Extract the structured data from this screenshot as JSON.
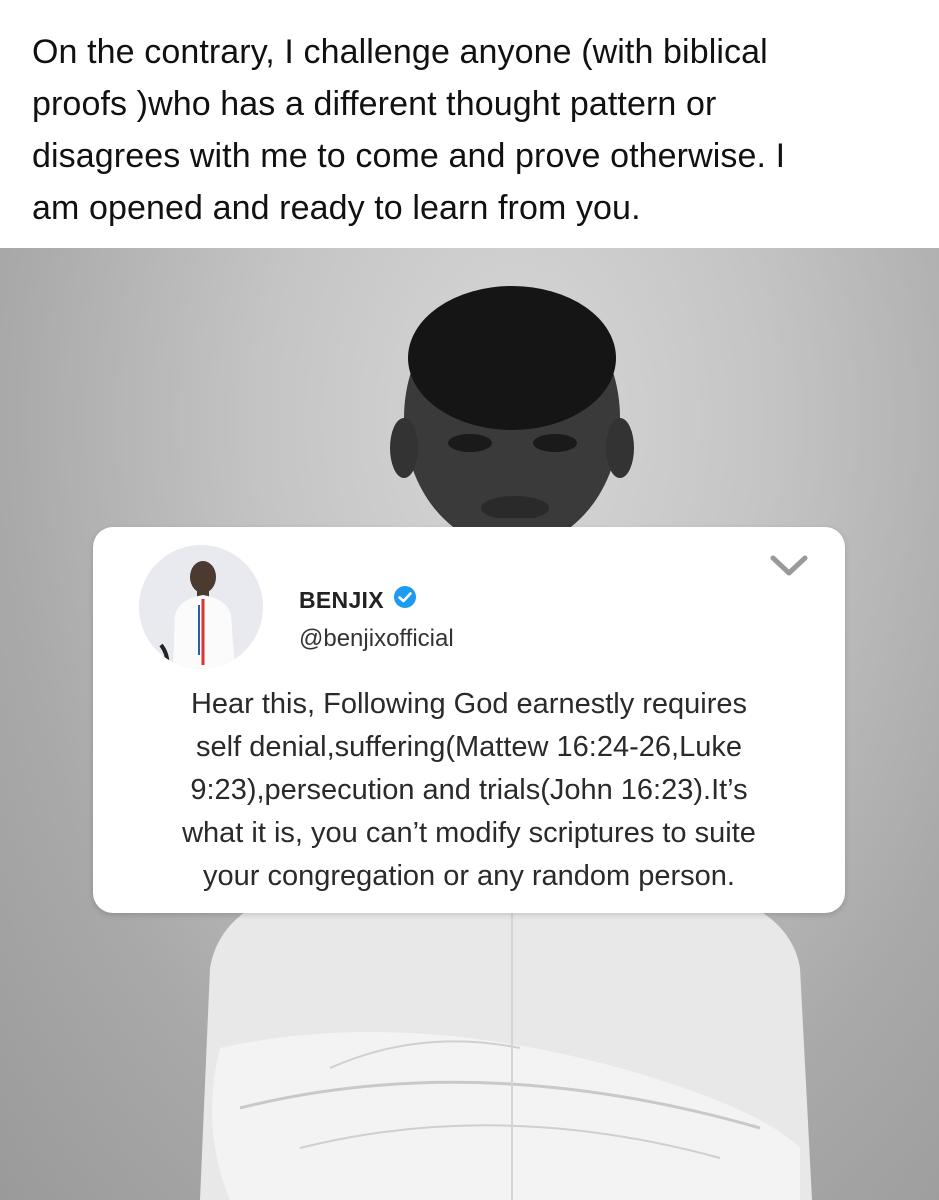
{
  "caption": {
    "line1": "On the contrary, I challenge anyone (with biblical",
    "line2": "proofs )who has a different thought pattern or",
    "line3": "disagrees with me to come and prove otherwise. I",
    "line4": "am opened and ready to learn from you."
  },
  "tweet": {
    "display_name": "BENJIX",
    "handle": "@benjixofficial",
    "verified_icon": "verified-badge-icon",
    "menu_icon": "chevron-down-icon",
    "text_lines": [
      "Hear this, Following God earnestly requires",
      "self denial,suffering(Mattew 16:24-26,Luke",
      "9:23),persecution and trials(John 16:23).It’s",
      "what it is, you can’t modify scriptures to suite",
      "your congregation or any random person."
    ]
  },
  "colors": {
    "verified_blue": "#1d9bf0",
    "chevron_gray": "#9a9a9a",
    "caption_text": "#111111"
  }
}
